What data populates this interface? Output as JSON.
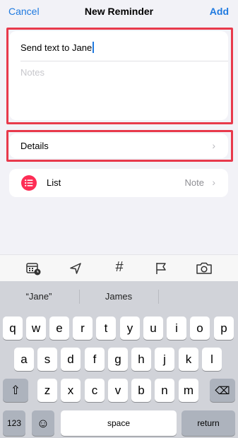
{
  "nav": {
    "cancel": "Cancel",
    "title": "New Reminder",
    "add": "Add"
  },
  "reminder": {
    "title_value": "Send text to Jane",
    "notes_placeholder": "Notes"
  },
  "details": {
    "label": "Details"
  },
  "list": {
    "label": "List",
    "value": "Note"
  },
  "toolbar": {
    "icons": [
      "calendar-clock-icon",
      "location-icon",
      "hashtag-icon",
      "flag-icon",
      "camera-icon"
    ],
    "hashtag": "#"
  },
  "keyboard": {
    "predictions": [
      "“Jane”",
      "James",
      ""
    ],
    "row1": [
      "q",
      "w",
      "e",
      "r",
      "t",
      "y",
      "u",
      "i",
      "o",
      "p"
    ],
    "row2": [
      "a",
      "s",
      "d",
      "f",
      "g",
      "h",
      "j",
      "k",
      "l"
    ],
    "row3": [
      "z",
      "x",
      "c",
      "v",
      "b",
      "n",
      "m"
    ],
    "numbers_key": "123",
    "space_key": "space",
    "return_key": "return",
    "shift_glyph": "⇧",
    "delete_glyph": "⌫",
    "emoji_glyph": "☺"
  },
  "colors": {
    "accent": "#1f7ae0",
    "highlight": "#e8394b",
    "list_icon": "#fd2d55"
  }
}
